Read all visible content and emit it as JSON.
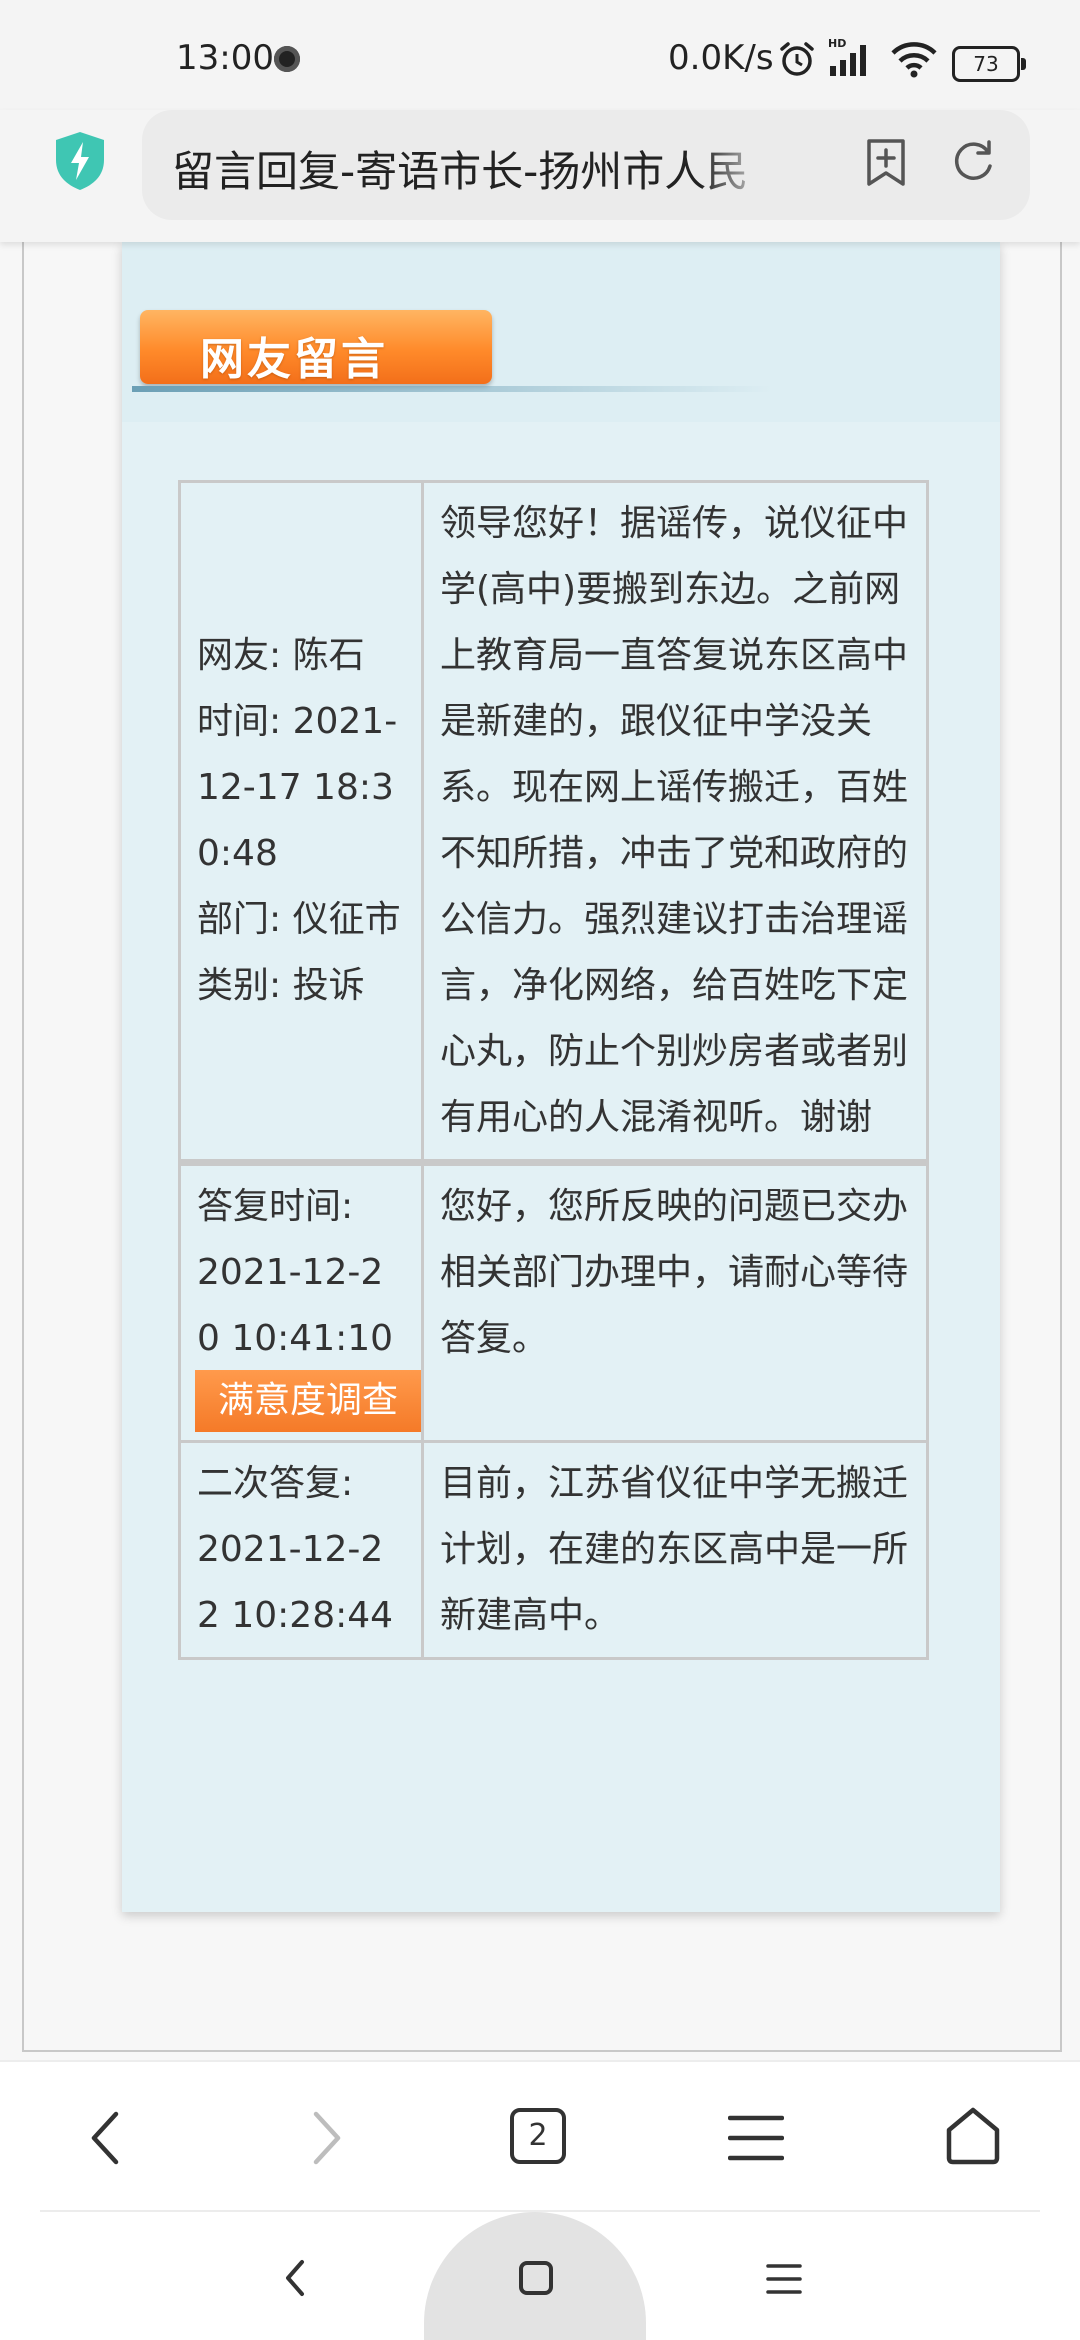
{
  "status_bar": {
    "time": "13:00",
    "net_speed": "0.0K/s",
    "battery": "73",
    "icons": [
      "screen-record-icon",
      "alarm-icon",
      "hd-signal-icon",
      "wifi-icon",
      "battery-icon"
    ]
  },
  "browser": {
    "url_title": "留言回复-寄语市长-扬州市人民",
    "icons": [
      "shield-bolt-icon",
      "add-bookmark-icon",
      "reload-icon"
    ]
  },
  "section": {
    "title": "网友留言"
  },
  "message": {
    "user_line": "网友: 陈石",
    "time_line": "时间: 2021-12-17 18:30:48",
    "dept_line": "部门: 仪征市",
    "category_line": "类别: 投诉",
    "content": "领导您好！据谣传，说仪征中学(高中)要搬到东边。之前网上教育局一直答复说东区高中是新建的，跟仪征中学没关系。现在网上谣传搬迁，百姓不知所措，冲击了党和政府的公信力。强烈建议打击治理谣言，净化网络，给百姓吃下定心丸，防止个别炒房者或者别有用心的人混淆视听。谢谢"
  },
  "reply": {
    "label": "答复时间:",
    "time": "2021-12-20 10:41:10",
    "survey_button": "满意度调查",
    "content": "您好，您所反映的问题已交办相关部门办理中，请耐心等待答复。"
  },
  "second_reply": {
    "label": "二次答复:",
    "time": "2021-12-22 10:28:44",
    "content": "目前，江苏省仪征中学无搬迁计划，在建的东区高中是一所新建高中。"
  },
  "toolbar": {
    "tab_count": "2",
    "icons": [
      "back-icon",
      "forward-icon",
      "tabs-icon",
      "menu-icon",
      "home-icon"
    ]
  },
  "colors": {
    "accent_orange": "#f57a28",
    "panel_bg": "#e3f1f5",
    "border": "#c9c9c9"
  }
}
